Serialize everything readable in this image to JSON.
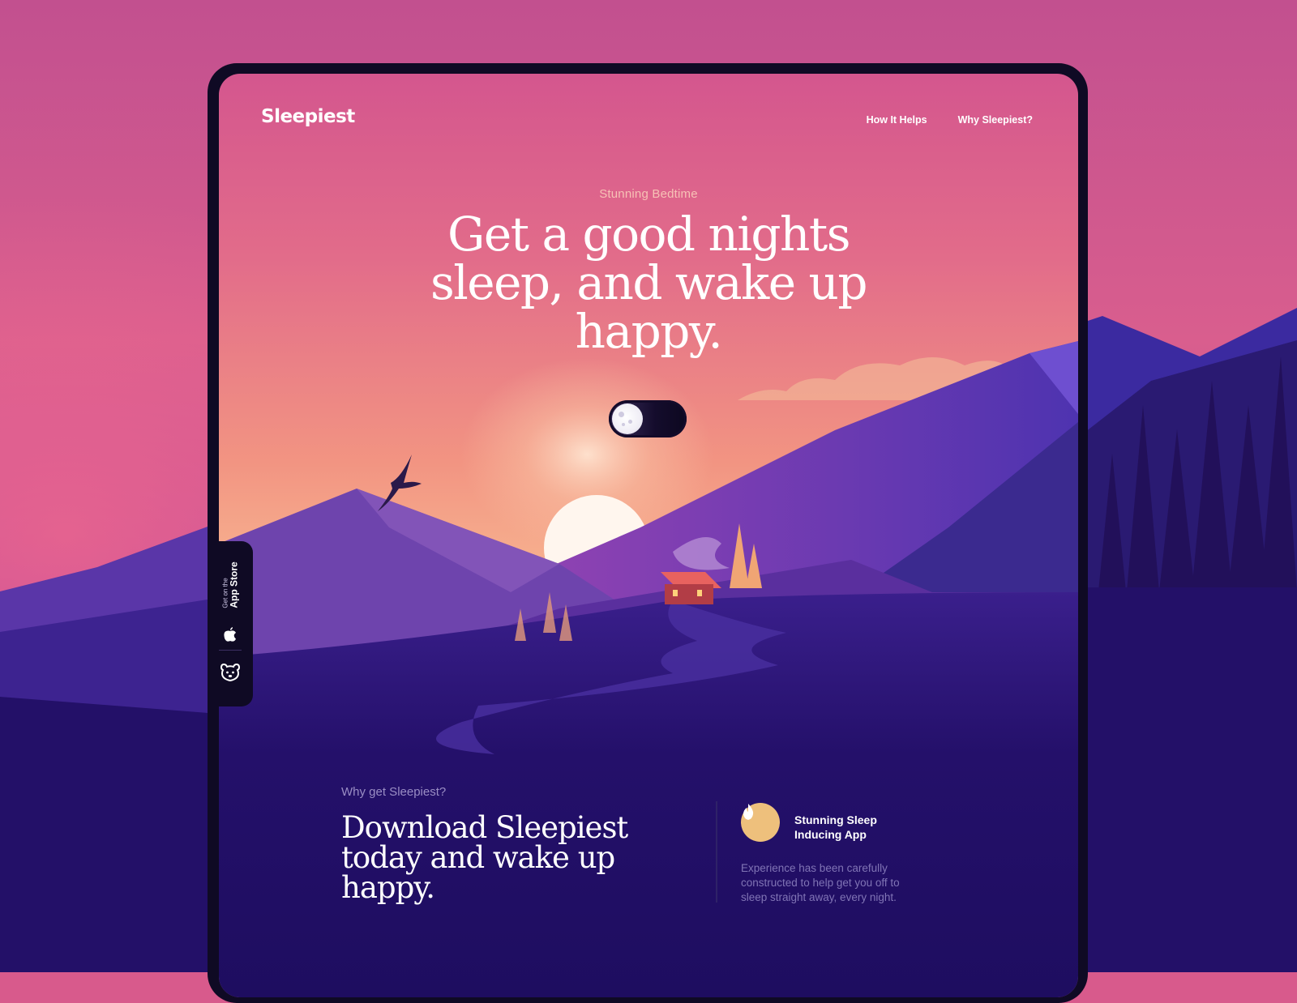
{
  "brand": {
    "logo": "Sleepiest"
  },
  "nav": {
    "items": [
      "How It Helps",
      "Why Sleepiest?"
    ]
  },
  "hero": {
    "eyebrow": "Stunning Bedtime",
    "headline_lines": [
      "Get a good nights",
      "sleep, and wake up",
      "happy."
    ],
    "toggle": {
      "state": "night",
      "icon": "moon-icon"
    }
  },
  "app_store_badge": {
    "small": "Get on the",
    "big": "App Store",
    "icon": "apple-icon"
  },
  "sidebar_icon": "bear-icon",
  "why": {
    "eyebrow": "Why get Sleepiest?",
    "title_lines": [
      "Download Sleepiest",
      "today and wake up",
      "happy."
    ]
  },
  "feature": {
    "icon": "flame-icon",
    "title_lines": [
      "Stunning Sleep",
      "Inducing App"
    ],
    "description_lines": [
      "Experience has been carefully",
      "constructed to help get you off to",
      "sleep straight away, every night."
    ]
  },
  "colors": {
    "sky_top": "#d85a8c",
    "sky_glow": "#f4a58a",
    "mountain": "#5a36a8",
    "ground": "#231068",
    "accent": "#eec07c",
    "frame": "#0f0a24"
  }
}
